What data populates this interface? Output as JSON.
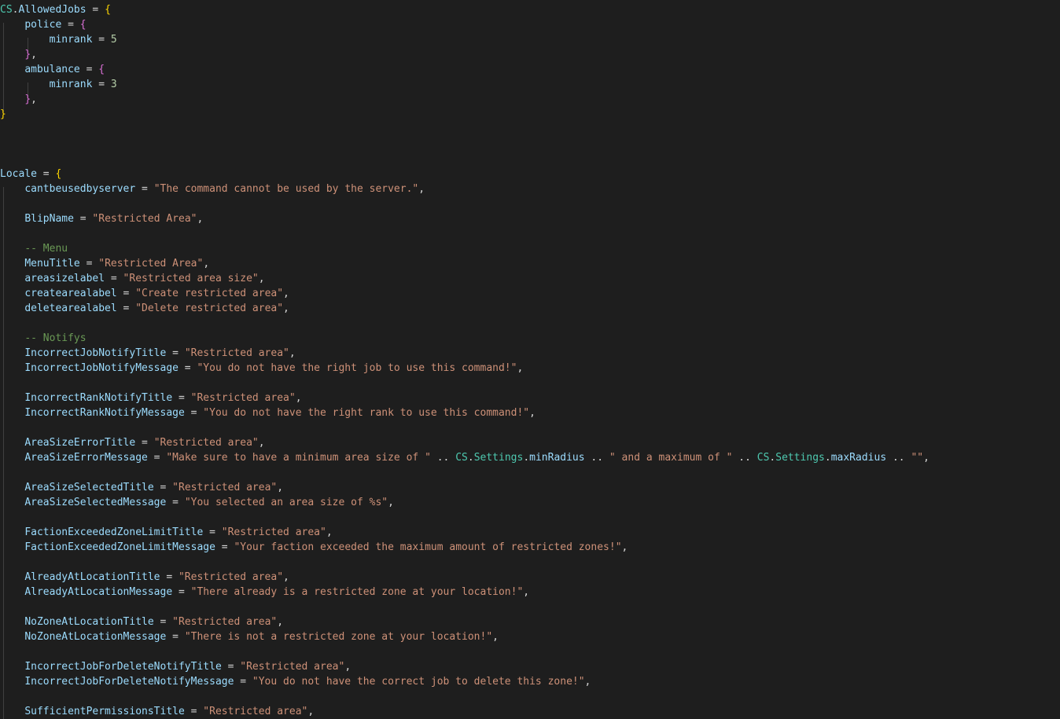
{
  "lines": [
    [
      {
        "t": "CS",
        "c": "class"
      },
      {
        "t": ".",
        "c": "op"
      },
      {
        "t": "AllowedJobs",
        "c": "var"
      },
      {
        "t": " = ",
        "c": "op"
      },
      {
        "t": "{",
        "c": "b1"
      }
    ],
    [
      {
        "t": "    ",
        "c": "op"
      },
      {
        "t": "police",
        "c": "var"
      },
      {
        "t": " = ",
        "c": "op"
      },
      {
        "t": "{",
        "c": "b2"
      }
    ],
    [
      {
        "t": "        ",
        "c": "op"
      },
      {
        "t": "minrank",
        "c": "var"
      },
      {
        "t": " = ",
        "c": "op"
      },
      {
        "t": "5",
        "c": "num"
      }
    ],
    [
      {
        "t": "    ",
        "c": "op"
      },
      {
        "t": "}",
        "c": "b2"
      },
      {
        "t": ",",
        "c": "op"
      }
    ],
    [
      {
        "t": "    ",
        "c": "op"
      },
      {
        "t": "ambulance",
        "c": "var"
      },
      {
        "t": " = ",
        "c": "op"
      },
      {
        "t": "{",
        "c": "b2"
      }
    ],
    [
      {
        "t": "        ",
        "c": "op"
      },
      {
        "t": "minrank",
        "c": "var"
      },
      {
        "t": " = ",
        "c": "op"
      },
      {
        "t": "3",
        "c": "num"
      }
    ],
    [
      {
        "t": "    ",
        "c": "op"
      },
      {
        "t": "}",
        "c": "b2"
      },
      {
        "t": ",",
        "c": "op"
      }
    ],
    [
      {
        "t": "}",
        "c": "b1"
      }
    ],
    [],
    [],
    [],
    [
      {
        "t": "Locale",
        "c": "var"
      },
      {
        "t": " = ",
        "c": "op"
      },
      {
        "t": "{",
        "c": "b1"
      }
    ],
    [
      {
        "t": "    ",
        "c": "op"
      },
      {
        "t": "cantbeusedbyserver",
        "c": "var"
      },
      {
        "t": " = ",
        "c": "op"
      },
      {
        "t": "\"The command cannot be used by the server.\"",
        "c": "str"
      },
      {
        "t": ",",
        "c": "op"
      }
    ],
    [],
    [
      {
        "t": "    ",
        "c": "op"
      },
      {
        "t": "BlipName",
        "c": "var"
      },
      {
        "t": " = ",
        "c": "op"
      },
      {
        "t": "\"Restricted Area\"",
        "c": "str"
      },
      {
        "t": ",",
        "c": "op"
      }
    ],
    [],
    [
      {
        "t": "    ",
        "c": "op"
      },
      {
        "t": "-- Menu",
        "c": "com"
      }
    ],
    [
      {
        "t": "    ",
        "c": "op"
      },
      {
        "t": "MenuTitle",
        "c": "var"
      },
      {
        "t": " = ",
        "c": "op"
      },
      {
        "t": "\"Restricted Area\"",
        "c": "str"
      },
      {
        "t": ",",
        "c": "op"
      }
    ],
    [
      {
        "t": "    ",
        "c": "op"
      },
      {
        "t": "areasizelabel",
        "c": "var"
      },
      {
        "t": " = ",
        "c": "op"
      },
      {
        "t": "\"Restricted area size\"",
        "c": "str"
      },
      {
        "t": ",",
        "c": "op"
      }
    ],
    [
      {
        "t": "    ",
        "c": "op"
      },
      {
        "t": "createarealabel",
        "c": "var"
      },
      {
        "t": " = ",
        "c": "op"
      },
      {
        "t": "\"Create restricted area\"",
        "c": "str"
      },
      {
        "t": ",",
        "c": "op"
      }
    ],
    [
      {
        "t": "    ",
        "c": "op"
      },
      {
        "t": "deletearealabel",
        "c": "var"
      },
      {
        "t": " = ",
        "c": "op"
      },
      {
        "t": "\"Delete restricted area\"",
        "c": "str"
      },
      {
        "t": ",",
        "c": "op"
      }
    ],
    [],
    [
      {
        "t": "    ",
        "c": "op"
      },
      {
        "t": "-- Notifys",
        "c": "com"
      }
    ],
    [
      {
        "t": "    ",
        "c": "op"
      },
      {
        "t": "IncorrectJobNotifyTitle",
        "c": "var"
      },
      {
        "t": " = ",
        "c": "op"
      },
      {
        "t": "\"Restricted area\"",
        "c": "str"
      },
      {
        "t": ",",
        "c": "op"
      }
    ],
    [
      {
        "t": "    ",
        "c": "op"
      },
      {
        "t": "IncorrectJobNotifyMessage",
        "c": "var"
      },
      {
        "t": " = ",
        "c": "op"
      },
      {
        "t": "\"You do not have the right job to use this command!\"",
        "c": "str"
      },
      {
        "t": ",",
        "c": "op"
      }
    ],
    [],
    [
      {
        "t": "    ",
        "c": "op"
      },
      {
        "t": "IncorrectRankNotifyTitle",
        "c": "var"
      },
      {
        "t": " = ",
        "c": "op"
      },
      {
        "t": "\"Restricted area\"",
        "c": "str"
      },
      {
        "t": ",",
        "c": "op"
      }
    ],
    [
      {
        "t": "    ",
        "c": "op"
      },
      {
        "t": "IncorrectRankNotifyMessage",
        "c": "var"
      },
      {
        "t": " = ",
        "c": "op"
      },
      {
        "t": "\"You do not have the right rank to use this command!\"",
        "c": "str"
      },
      {
        "t": ",",
        "c": "op"
      }
    ],
    [],
    [
      {
        "t": "    ",
        "c": "op"
      },
      {
        "t": "AreaSizeErrorTitle",
        "c": "var"
      },
      {
        "t": " = ",
        "c": "op"
      },
      {
        "t": "\"Restricted area\"",
        "c": "str"
      },
      {
        "t": ",",
        "c": "op"
      }
    ],
    [
      {
        "t": "    ",
        "c": "op"
      },
      {
        "t": "AreaSizeErrorMessage",
        "c": "var"
      },
      {
        "t": " = ",
        "c": "op"
      },
      {
        "t": "\"Make sure to have a minimum area size of \"",
        "c": "str"
      },
      {
        "t": " .. ",
        "c": "op"
      },
      {
        "t": "CS",
        "c": "class"
      },
      {
        "t": ".",
        "c": "op"
      },
      {
        "t": "Settings",
        "c": "class"
      },
      {
        "t": ".",
        "c": "op"
      },
      {
        "t": "minRadius",
        "c": "var"
      },
      {
        "t": " .. ",
        "c": "op"
      },
      {
        "t": "\" and a maximum of \"",
        "c": "str"
      },
      {
        "t": " .. ",
        "c": "op"
      },
      {
        "t": "CS",
        "c": "class"
      },
      {
        "t": ".",
        "c": "op"
      },
      {
        "t": "Settings",
        "c": "class"
      },
      {
        "t": ".",
        "c": "op"
      },
      {
        "t": "maxRadius",
        "c": "var"
      },
      {
        "t": " .. ",
        "c": "op"
      },
      {
        "t": "\"\"",
        "c": "str"
      },
      {
        "t": ",",
        "c": "op"
      }
    ],
    [],
    [
      {
        "t": "    ",
        "c": "op"
      },
      {
        "t": "AreaSizeSelectedTitle",
        "c": "var"
      },
      {
        "t": " = ",
        "c": "op"
      },
      {
        "t": "\"Restricted area\"",
        "c": "str"
      },
      {
        "t": ",",
        "c": "op"
      }
    ],
    [
      {
        "t": "    ",
        "c": "op"
      },
      {
        "t": "AreaSizeSelectedMessage",
        "c": "var"
      },
      {
        "t": " = ",
        "c": "op"
      },
      {
        "t": "\"You selected an area size of %s\"",
        "c": "str"
      },
      {
        "t": ",",
        "c": "op"
      }
    ],
    [],
    [
      {
        "t": "    ",
        "c": "op"
      },
      {
        "t": "FactionExceededZoneLimitTitle",
        "c": "var"
      },
      {
        "t": " = ",
        "c": "op"
      },
      {
        "t": "\"Restricted area\"",
        "c": "str"
      },
      {
        "t": ",",
        "c": "op"
      }
    ],
    [
      {
        "t": "    ",
        "c": "op"
      },
      {
        "t": "FactionExceededZoneLimitMessage",
        "c": "var"
      },
      {
        "t": " = ",
        "c": "op"
      },
      {
        "t": "\"Your faction exceeded the maximum amount of restricted zones!\"",
        "c": "str"
      },
      {
        "t": ",",
        "c": "op"
      }
    ],
    [],
    [
      {
        "t": "    ",
        "c": "op"
      },
      {
        "t": "AlreadyAtLocationTitle",
        "c": "var"
      },
      {
        "t": " = ",
        "c": "op"
      },
      {
        "t": "\"Restricted area\"",
        "c": "str"
      },
      {
        "t": ",",
        "c": "op"
      }
    ],
    [
      {
        "t": "    ",
        "c": "op"
      },
      {
        "t": "AlreadyAtLocationMessage",
        "c": "var"
      },
      {
        "t": " = ",
        "c": "op"
      },
      {
        "t": "\"There already is a restricted zone at your location!\"",
        "c": "str"
      },
      {
        "t": ",",
        "c": "op"
      }
    ],
    [],
    [
      {
        "t": "    ",
        "c": "op"
      },
      {
        "t": "NoZoneAtLocationTitle",
        "c": "var"
      },
      {
        "t": " = ",
        "c": "op"
      },
      {
        "t": "\"Restricted area\"",
        "c": "str"
      },
      {
        "t": ",",
        "c": "op"
      }
    ],
    [
      {
        "t": "    ",
        "c": "op"
      },
      {
        "t": "NoZoneAtLocationMessage",
        "c": "var"
      },
      {
        "t": " = ",
        "c": "op"
      },
      {
        "t": "\"There is not a restricted zone at your location!\"",
        "c": "str"
      },
      {
        "t": ",",
        "c": "op"
      }
    ],
    [],
    [
      {
        "t": "    ",
        "c": "op"
      },
      {
        "t": "IncorrectJobForDeleteNotifyTitle",
        "c": "var"
      },
      {
        "t": " = ",
        "c": "op"
      },
      {
        "t": "\"Restricted area\"",
        "c": "str"
      },
      {
        "t": ",",
        "c": "op"
      }
    ],
    [
      {
        "t": "    ",
        "c": "op"
      },
      {
        "t": "IncorrectJobForDeleteNotifyMessage",
        "c": "var"
      },
      {
        "t": " = ",
        "c": "op"
      },
      {
        "t": "\"You do not have the correct job to delete this zone!\"",
        "c": "str"
      },
      {
        "t": ",",
        "c": "op"
      }
    ],
    [],
    [
      {
        "t": "    ",
        "c": "op"
      },
      {
        "t": "SufficientPermissionsTitle",
        "c": "var"
      },
      {
        "t": " = ",
        "c": "op"
      },
      {
        "t": "\"Restricted area\"",
        "c": "str"
      },
      {
        "t": ",",
        "c": "op"
      }
    ]
  ]
}
